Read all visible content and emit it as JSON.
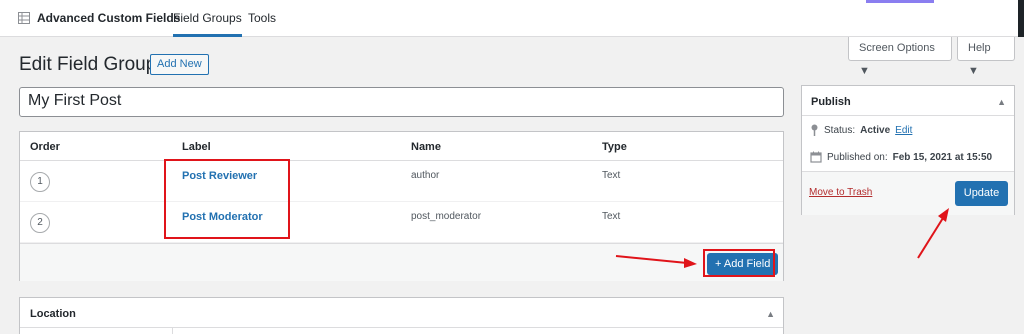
{
  "header": {
    "brand": "Advanced Custom Fields",
    "tabs": [
      "Field Groups",
      "Tools"
    ],
    "brand_icon": "grid-icon"
  },
  "screen_meta": {
    "screen_options": "Screen Options ▼",
    "help": "Help ▼"
  },
  "page": {
    "title": "Edit Field Group",
    "add_new": "Add New",
    "post_title": "My First Post"
  },
  "fields_table": {
    "columns": [
      "Order",
      "Label",
      "Name",
      "Type"
    ],
    "rows": [
      {
        "order": "1",
        "label": "Post Reviewer",
        "name": "author",
        "type": "Text"
      },
      {
        "order": "2",
        "label": "Post Moderator",
        "name": "post_moderator",
        "type": "Text"
      }
    ],
    "add_field": "+ Add Field"
  },
  "location": {
    "title": "Location",
    "toggle": "▲"
  },
  "publish": {
    "title": "Publish",
    "toggle": "▲",
    "status_label": "Status:",
    "status_value": "Active",
    "status_edit": "Edit",
    "published_label": "Published on:",
    "published_value": "Feb 15, 2021 at 15:50",
    "move_to_trash": "Move to Trash",
    "update": "Update",
    "status_icon": "pin-icon",
    "date_icon": "calendar-icon"
  },
  "colors": {
    "accent": "#2271b1",
    "annotation": "#e0141a"
  }
}
